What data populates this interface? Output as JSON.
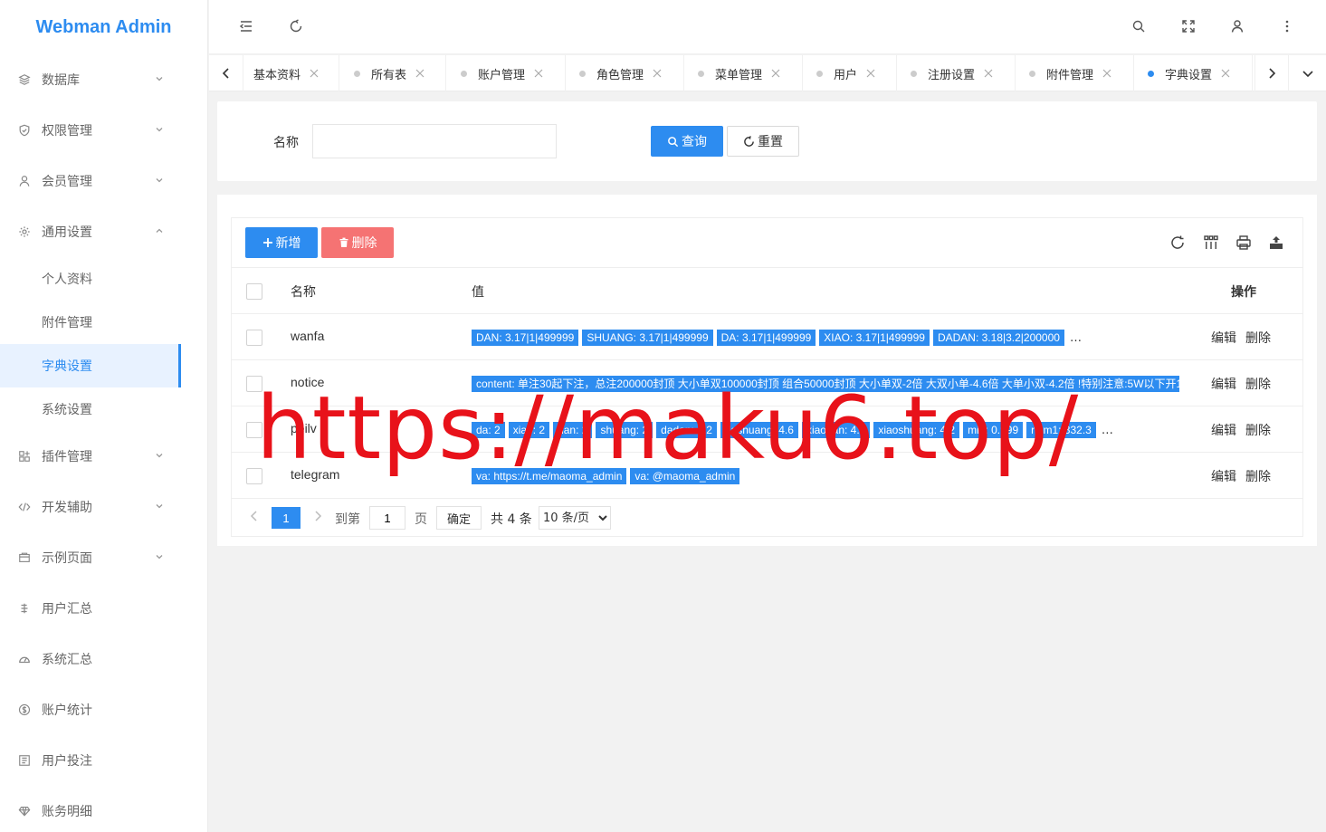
{
  "app": {
    "title": "Webman Admin"
  },
  "sidebar": {
    "items": [
      {
        "label": "数据库",
        "icon": "layers-icon"
      },
      {
        "label": "权限管理",
        "icon": "shield-icon"
      },
      {
        "label": "会员管理",
        "icon": "user-icon"
      },
      {
        "label": "通用设置",
        "icon": "gear-icon"
      },
      {
        "label": "插件管理",
        "icon": "apps-icon"
      },
      {
        "label": "开发辅助",
        "icon": "code-icon"
      },
      {
        "label": "示例页面",
        "icon": "folder-icon"
      },
      {
        "label": "用户汇总",
        "icon": "sum-icon"
      },
      {
        "label": "系统汇总",
        "icon": "dashboard-icon"
      },
      {
        "label": "账户统计",
        "icon": "dollar-icon"
      },
      {
        "label": "用户投注",
        "icon": "list-icon"
      },
      {
        "label": "账务明细",
        "icon": "diamond-icon"
      }
    ],
    "sub_items": [
      {
        "label": "个人资料"
      },
      {
        "label": "附件管理"
      },
      {
        "label": "字典设置",
        "active": true
      },
      {
        "label": "系统设置"
      }
    ]
  },
  "tabs": [
    {
      "label": "基本资料"
    },
    {
      "label": "所有表"
    },
    {
      "label": "账户管理"
    },
    {
      "label": "角色管理"
    },
    {
      "label": "菜单管理"
    },
    {
      "label": "用户"
    },
    {
      "label": "注册设置"
    },
    {
      "label": "附件管理"
    },
    {
      "label": "字典设置",
      "active": true
    }
  ],
  "search": {
    "label": "名称",
    "value": "",
    "query_label": "查询",
    "reset_label": "重置"
  },
  "toolbar": {
    "add_label": "新增",
    "delete_label": "删除"
  },
  "table": {
    "headers": {
      "name": "名称",
      "value": "值",
      "ops": "操作"
    },
    "rows": [
      {
        "name": "wanfa",
        "tags": [
          "DAN: 3.17|1|499999",
          "SHUANG: 3.17|1|499999",
          "DA: 3.17|1|499999",
          "XIAO: 3.17|1|499999",
          "DADAN: 3.18|3.2|200000"
        ],
        "more": "…"
      },
      {
        "name": "notice",
        "tags": [
          "content: 单注30起下注，总注200000封顶 大小单双100000封顶 组合50000封顶 大小单双-2倍 大双小单-4.6倍 大单小双-4.2倍 !特别注意:5W以下开1"
        ],
        "more": ""
      },
      {
        "name": "peilv",
        "tags": [
          "da: 2",
          "xiao: 2",
          "dan: 2",
          "shuang: 2",
          "dadan: 4.2",
          "dashuang: 4.6",
          "xiaodan: 4.6",
          "xiaoshuang: 4.2",
          "min: 0.999",
          "num1: 332.3"
        ],
        "more": "…"
      },
      {
        "name": "telegram",
        "tags": [
          "va: https://t.me/maoma_admin",
          "va: @maoma_admin"
        ],
        "more": ""
      }
    ],
    "edit_label": "编辑",
    "delete_label": "删除"
  },
  "pager": {
    "current": "1",
    "goto_label": "到第",
    "goto_value": "1",
    "page_label": "页",
    "confirm_label": "确定",
    "total_label": "共 4 条",
    "page_size": "10 条/页"
  },
  "watermark": "https://maku6.top/",
  "colors": {
    "accent": "#2d8cf0",
    "danger": "#f56c6c",
    "watermark": "#e8121a"
  }
}
